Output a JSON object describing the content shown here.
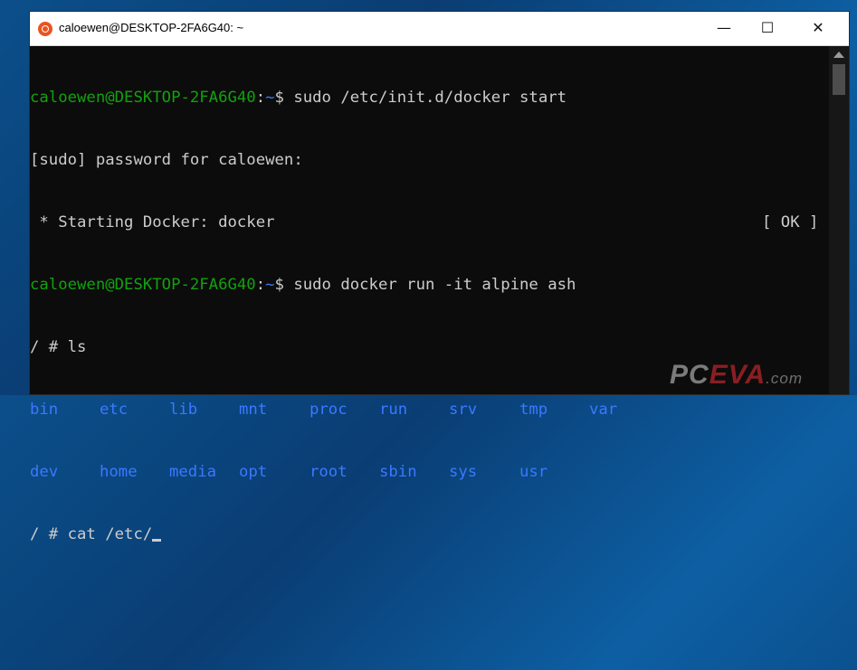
{
  "window": {
    "title": "caloewen@DESKTOP-2FA6G40: ~",
    "app_icon": "ubuntu-icon",
    "controls": {
      "minimize": "—",
      "maximize": "☐",
      "close": "✕"
    }
  },
  "colors": {
    "prompt_user": "#13a10e",
    "prompt_path": "#3b78ff",
    "directory": "#3b78ff",
    "text": "#cccccc",
    "background": "#0c0c0c"
  },
  "terminal": {
    "line1": {
      "user": "caloewen@DESKTOP-2FA6G40",
      "sep": ":",
      "path": "~",
      "cmd": "$ sudo /etc/init.d/docker start"
    },
    "line2": "[sudo] password for caloewen:",
    "line3": {
      "text": " * Starting Docker: docker",
      "status": "[ OK ]"
    },
    "line4": {
      "user": "caloewen@DESKTOP-2FA6G40",
      "sep": ":",
      "path": "~",
      "cmd": "$ sudo docker run -it alpine ash"
    },
    "line5": "/ # ls",
    "ls_row1": [
      "bin",
      "etc",
      "lib",
      "mnt",
      "proc",
      "run",
      "srv",
      "tmp",
      "var"
    ],
    "ls_row2": [
      "dev",
      "home",
      "media",
      "opt",
      "root",
      "sbin",
      "sys",
      "usr"
    ],
    "line8": "/ # cat /etc/"
  },
  "watermark": {
    "pc": "PC",
    "eva": "EVA",
    "com": ".com"
  }
}
